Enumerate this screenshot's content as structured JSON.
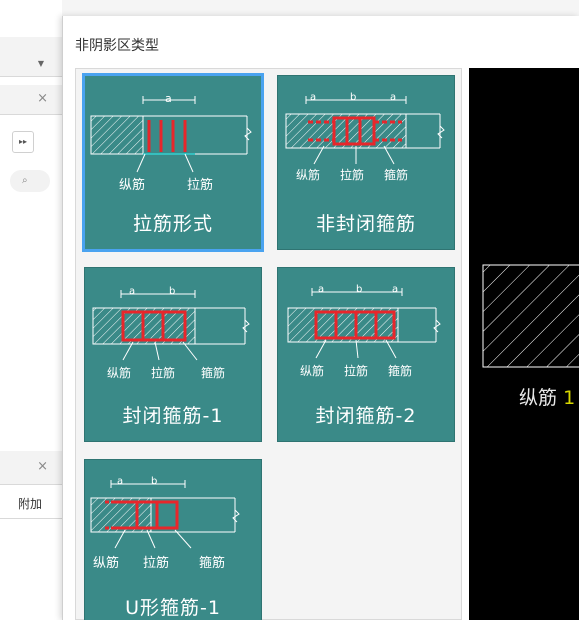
{
  "background": {
    "left_rows": [
      "",
      "",
      "",
      ""
    ],
    "bottom_label": "附加",
    "close_glyph": "×",
    "search_icon": "search-icon"
  },
  "dialog": {
    "title": "非阴影区类型",
    "tiles": [
      {
        "caption": "拉筋形式",
        "labels": [
          "纵筋",
          "拉筋"
        ],
        "dims": [
          "a"
        ],
        "selected": true
      },
      {
        "caption": "非封闭箍筋",
        "labels": [
          "纵筋",
          "拉筋",
          "箍筋"
        ],
        "dims": [
          "a",
          "b",
          "a"
        ],
        "selected": false
      },
      {
        "caption": "封闭箍筋-1",
        "labels": [
          "纵筋",
          "拉筋",
          "箍筋"
        ],
        "dims": [
          "a",
          "b"
        ],
        "selected": false
      },
      {
        "caption": "封闭箍筋-2",
        "labels": [
          "纵筋",
          "拉筋",
          "箍筋"
        ],
        "dims": [
          "a",
          "b",
          "a"
        ],
        "selected": false
      },
      {
        "caption": "U形箍筋-1",
        "labels": [
          "纵筋",
          "拉筋",
          "箍筋"
        ],
        "dims": [
          "a",
          "b"
        ],
        "selected": false
      }
    ],
    "preview": {
      "label": "纵筋",
      "accent": "1"
    }
  },
  "colors": {
    "tile_bg": "#3a8a88",
    "selected_outline": "#4aa3f0",
    "rebar_red": "#e8262b",
    "stirrup_cyan": "#35d0d0"
  }
}
